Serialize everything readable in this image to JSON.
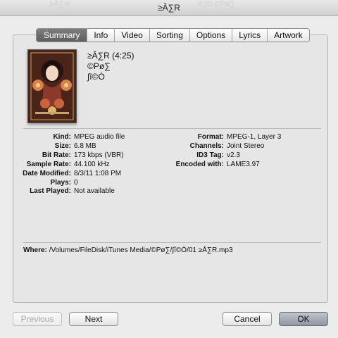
{
  "window": {
    "title": "≥Â∑R",
    "ghost_text_left": "≥Â∑R",
    "ghost_text_right": "4:25 ©Pø∑"
  },
  "tabs": [
    {
      "label": "Summary",
      "active": true
    },
    {
      "label": "Info",
      "active": false
    },
    {
      "label": "Video",
      "active": false
    },
    {
      "label": "Sorting",
      "active": false
    },
    {
      "label": "Options",
      "active": false
    },
    {
      "label": "Lyrics",
      "active": false
    },
    {
      "label": "Artwork",
      "active": false
    }
  ],
  "song": {
    "title_line": "≥Â∑R (4:25)",
    "artist": "©Pø∑",
    "album": "∫î©Ò"
  },
  "details_left": [
    {
      "label": "Kind:",
      "value": "MPEG audio file"
    },
    {
      "label": "Size:",
      "value": "6.8 MB"
    },
    {
      "label": "Bit Rate:",
      "value": "173 kbps (VBR)"
    },
    {
      "label": "Sample Rate:",
      "value": "44.100 kHz"
    },
    {
      "label": "Date Modified:",
      "value": "8/3/11 1:08 PM"
    },
    {
      "label": "Plays:",
      "value": "0"
    },
    {
      "label": "Last Played:",
      "value": "Not available"
    }
  ],
  "details_right": [
    {
      "label": "Format:",
      "value": "MPEG-1, Layer 3"
    },
    {
      "label": "Channels:",
      "value": "Joint Stereo"
    },
    {
      "label": "ID3 Tag:",
      "value": "v2.3"
    },
    {
      "label": "Encoded with:",
      "value": "LAME3.97"
    }
  ],
  "where": {
    "label": "Where:",
    "value": "/Volumes/FileDisk/iTunes Media/©Pø∑/∫î©Ò/01 ≥Â∑R.mp3"
  },
  "buttons": {
    "previous": "Previous",
    "next": "Next",
    "cancel": "Cancel",
    "ok": "OK"
  },
  "colors": {
    "window_bg": "#ececec",
    "panel_bg": "#e6e6e6",
    "active_tab": "#6a6a6a",
    "ok_button": "#9aa2ac"
  }
}
